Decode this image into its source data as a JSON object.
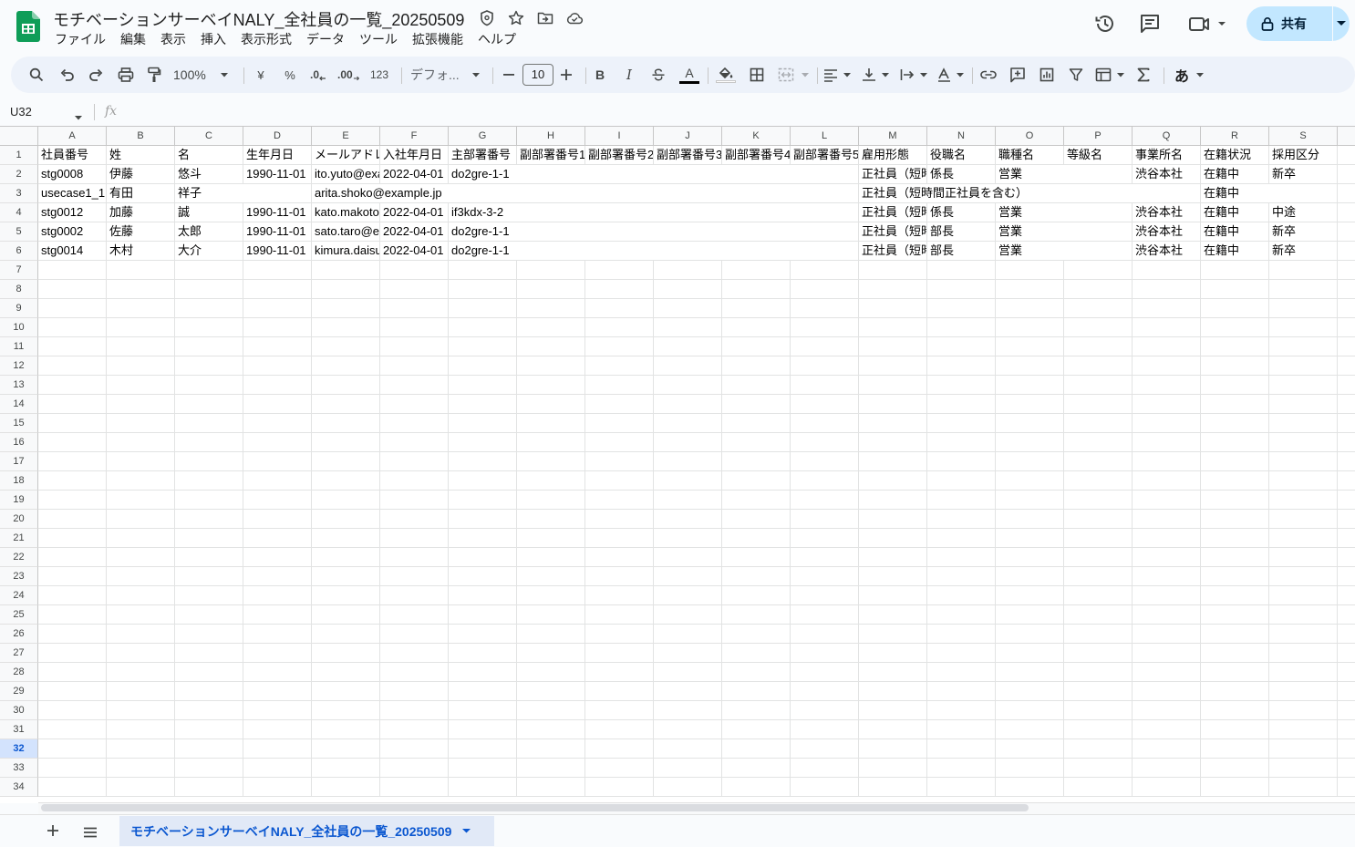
{
  "title_bar": {
    "doc_title": "モチベーションサーベイNALY_全社員の一覧_20250509",
    "share_label": "共有"
  },
  "menu": [
    "ファイル",
    "編集",
    "表示",
    "挿入",
    "表示形式",
    "データ",
    "ツール",
    "拡張機能",
    "ヘルプ"
  ],
  "toolbar": {
    "zoom": "100%",
    "currency": "¥",
    "percent": "%",
    "dec_decrease": ".0",
    "dec_increase": ".00",
    "number_format": "123",
    "font": "デフォ...",
    "font_size": "10",
    "bold": "B",
    "italic": "I",
    "text_color": "A",
    "input_tools": "あ"
  },
  "formula_bar": {
    "name_box": "U32",
    "fx": "fx"
  },
  "columns": [
    "A",
    "B",
    "C",
    "D",
    "E",
    "F",
    "G",
    "H",
    "I",
    "J",
    "K",
    "L",
    "M",
    "N",
    "O",
    "P",
    "Q",
    "R",
    "S"
  ],
  "row_numbers": [
    "1",
    "2",
    "3",
    "4",
    "5",
    "6",
    "7",
    "8",
    "9",
    "10",
    "11",
    "12",
    "13",
    "14",
    "15",
    "16",
    "17",
    "18",
    "19",
    "20",
    "21",
    "22",
    "23",
    "24",
    "25",
    "26",
    "27",
    "28",
    "29",
    "30",
    "31",
    "32",
    "33",
    "34"
  ],
  "selected_row": "32",
  "rows": [
    [
      "社員番号",
      "姓",
      "名",
      "生年月日",
      "メールアドレス",
      "入社年月日",
      "主部署番号",
      "副部署番号1",
      "副部署番号2",
      "副部署番号3",
      "副部署番号4",
      "副部署番号5",
      "雇用形態",
      "役職名",
      "職種名",
      "等級名",
      "事業所名",
      "在籍状況",
      "採用区分"
    ],
    [
      "stg0008",
      "伊藤",
      "悠斗",
      "1990-11-01",
      "ito.yuto@example.jp",
      "2022-04-01",
      "do2gre-1-1",
      "",
      "",
      "",
      "",
      "",
      "正社員（短時間正社員を含む）",
      "係長",
      "営業",
      "",
      "渋谷本社",
      "在籍中",
      "新卒"
    ],
    [
      "usecase1_1",
      "有田",
      "祥子",
      "",
      "arita.shoko@example.jp",
      "",
      "",
      "",
      "",
      "",
      "",
      "",
      "正社員（短時間正社員を含む）",
      "",
      "",
      "",
      "",
      "在籍中",
      ""
    ],
    [
      "stg0012",
      "加藤",
      "誠",
      "1990-11-01",
      "kato.makoto@example.jp",
      "2022-04-01",
      "if3kdx-3-2",
      "",
      "",
      "",
      "",
      "",
      "正社員（短時間正社員を含む）",
      "係長",
      "営業",
      "",
      "渋谷本社",
      "在籍中",
      "中途"
    ],
    [
      "stg0002",
      "佐藤",
      "太郎",
      "1990-11-01",
      "sato.taro@example.jp",
      "2022-04-01",
      "do2gre-1-1",
      "",
      "",
      "",
      "",
      "",
      "正社員（短時間正社員を含む）",
      "部長",
      "営業",
      "",
      "渋谷本社",
      "在籍中",
      "新卒"
    ],
    [
      "stg0014",
      "木村",
      "大介",
      "1990-11-01",
      "kimura.daisuke@example.jp",
      "2022-04-01",
      "do2gre-1-1",
      "",
      "",
      "",
      "",
      "",
      "正社員（短時間正社員を含む）",
      "部長",
      "営業",
      "",
      "渋谷本社",
      "在籍中",
      "新卒"
    ]
  ],
  "sheet_tab": "モチベーションサーベイNALY_全社員の一覧_20250509"
}
